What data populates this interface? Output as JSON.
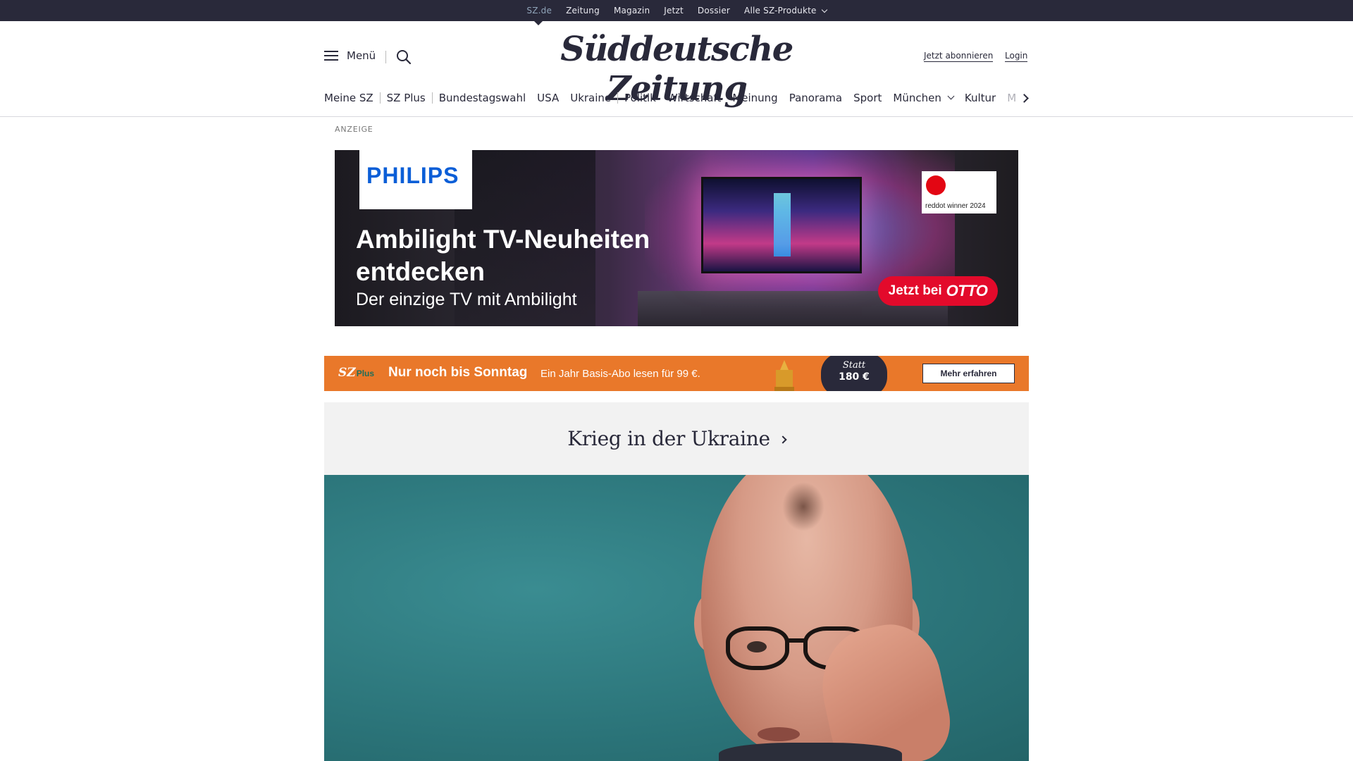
{
  "topbar": {
    "items": [
      "SZ.de",
      "Zeitung",
      "Magazin",
      "Jetzt",
      "Dossier",
      "Alle SZ-Produkte"
    ]
  },
  "header": {
    "menu_label": "Menü",
    "logo": "Süddeutsche Zeitung",
    "subscribe_label": "Jetzt abonnieren",
    "login_label": "Login"
  },
  "nav": {
    "items": [
      "Meine SZ",
      "SZ Plus",
      "Bundestagswahl",
      "USA",
      "Ukraine",
      "Politik",
      "Wirtschaft",
      "Meinung",
      "Panorama",
      "Sport",
      "München",
      "Kultur",
      "M"
    ]
  },
  "ad": {
    "label": "ANZEIGE",
    "brand": "PHILIPS",
    "title": "Ambilight TV-Neuheiten entdecken",
    "subtitle": "Der einzige TV mit Ambilight",
    "award": "reddot winner 2024",
    "cta": "Jetzt bei",
    "cta_brand": "OTTO"
  },
  "promo": {
    "logo": "SZ",
    "logo_plus": "Plus",
    "title": "Nur noch bis Sonntag",
    "text": "Ein Jahr Basis-Abo lesen für 99 €.",
    "statt": "Statt",
    "price": "180 €",
    "button": "Mehr erfahren"
  },
  "section": {
    "title": "Krieg in der Ukraine"
  },
  "colors": {
    "brand_dark": "#29293a",
    "promo_orange": "#e9782a",
    "hero_teal": "#2e7a80",
    "otto_red": "#e30a2b",
    "philips_blue": "#0b5ed7"
  }
}
